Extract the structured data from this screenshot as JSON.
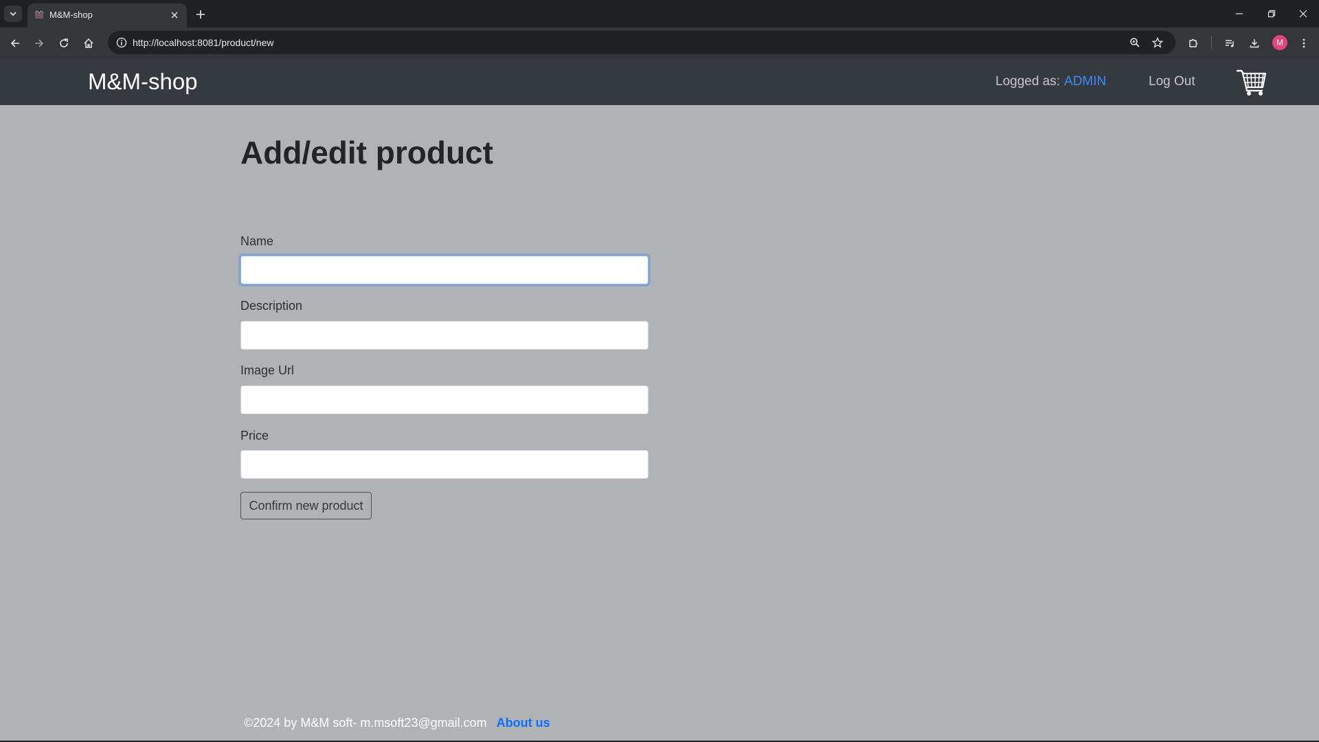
{
  "browser": {
    "tab_title": "M&M-shop",
    "url": "http://localhost:8081/product/new",
    "profile_initial": "M"
  },
  "navbar": {
    "brand": "M&M-shop",
    "logged_as_label": "Logged as:",
    "username": "ADMIN",
    "logout_label": "Log Out"
  },
  "form": {
    "title": "Add/edit product",
    "fields": [
      {
        "label": "Name",
        "value": ""
      },
      {
        "label": "Description",
        "value": ""
      },
      {
        "label": "Image Url",
        "value": ""
      },
      {
        "label": "Price",
        "value": ""
      }
    ],
    "submit_label": "Confirm new product"
  },
  "footer": {
    "text": "©2024 by M&M soft- m.msoft23@gmail.com",
    "about_label": "About us"
  },
  "colors": {
    "navbar_bg": "#343a40",
    "page_bg": "#b1b2b6",
    "link_blue": "#0d6efd",
    "username_blue": "#3d8bfd"
  }
}
